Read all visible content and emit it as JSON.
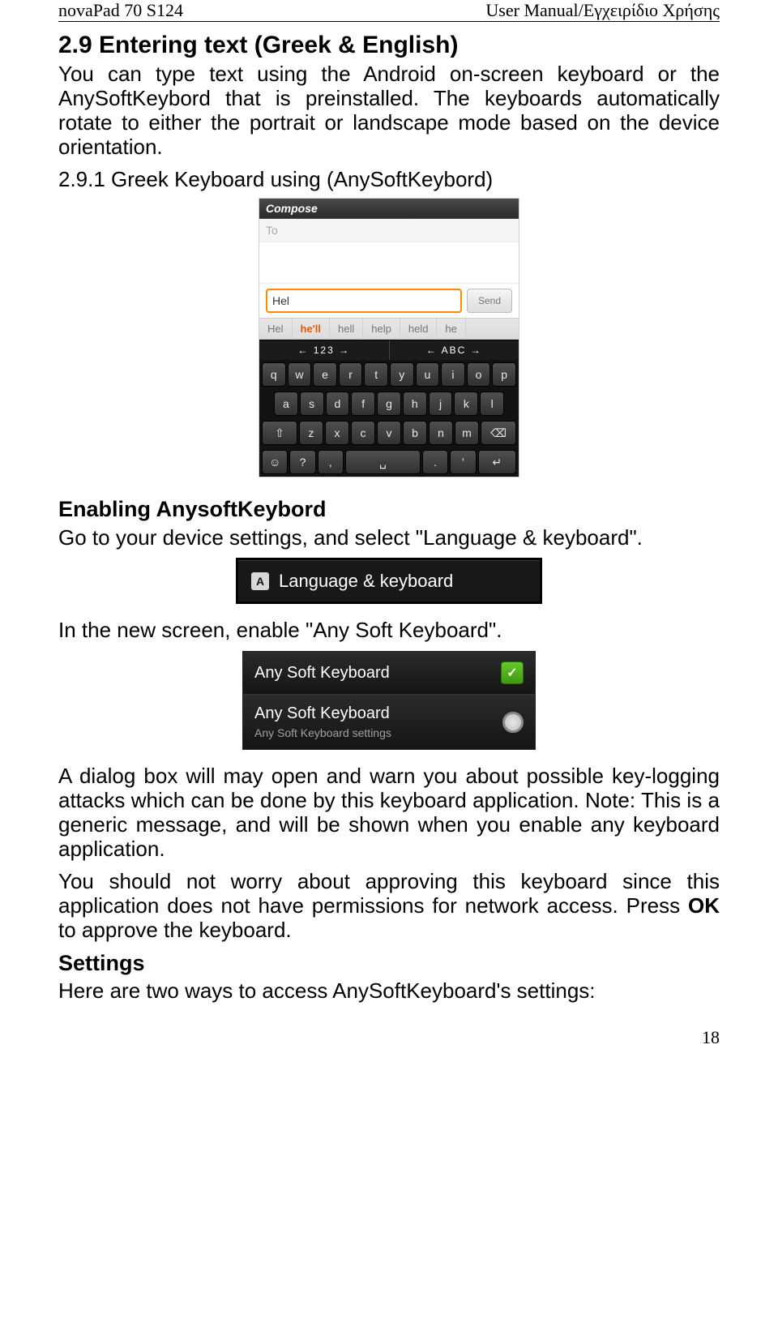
{
  "header": {
    "left": "novaPad 70 S124",
    "right": "User Manual/Εγχειρίδιο Χρήσης"
  },
  "section": {
    "title": "2.9 Entering text (Greek & English)",
    "intro": "You can type text using the Android on-screen keyboard or the AnySoftKeybord that is preinstalled. The keyboards automatically rotate to either the portrait or landscape mode based on the device orientation.",
    "sub_title": "2.9.1 Greek Keyboard using (AnySoftKeybord)"
  },
  "shot1": {
    "titlebar": "Compose",
    "to_label": "To",
    "input_value": "Hel",
    "send_label": "Send",
    "suggestions": [
      "Hel",
      "he'll",
      "hell",
      "help",
      "held",
      "he"
    ],
    "suggestion_highlight_index": 1,
    "mode_left": "← 123 →",
    "mode_right": "← ABC →",
    "kbd_rows": [
      [
        "q",
        "w",
        "e",
        "r",
        "t",
        "y",
        "u",
        "i",
        "o",
        "p"
      ],
      [
        "a",
        "s",
        "d",
        "f",
        "g",
        "h",
        "j",
        "k",
        "l"
      ],
      [
        "⇧",
        "z",
        "x",
        "c",
        "v",
        "b",
        "n",
        "m",
        "⌫"
      ],
      [
        "☺",
        "?",
        ",",
        "␣",
        ".",
        "'",
        "↵"
      ]
    ]
  },
  "enabling": {
    "heading": "Enabling AnysoftKeybord",
    "line1": "Go to your device settings, and select \"Language & keyboard\"."
  },
  "shot2": {
    "icon_letter": "A",
    "label": "Language & keyboard"
  },
  "between2and3": "In the new screen, enable \"Any Soft Keyboard\".",
  "shot3": {
    "row1_label": "Any Soft Keyboard",
    "row2_label": "Any Soft Keyboard",
    "row2_sub": "Any Soft Keyboard settings"
  },
  "after3": {
    "p1": "A dialog box will may open and warn you about possible key-logging attacks which can be done by this keyboard application. Note: This is a generic message, and will be shown when you enable any keyboard application.",
    "p2_a": "You should not worry about approving this keyboard since this application does not have permissions for network access. Press ",
    "p2_bold": "OK",
    "p2_b": " to approve the keyboard."
  },
  "settings": {
    "heading": "Settings",
    "line": "Here are two ways to access AnySoftKeyboard's settings:"
  },
  "page_number": "18"
}
